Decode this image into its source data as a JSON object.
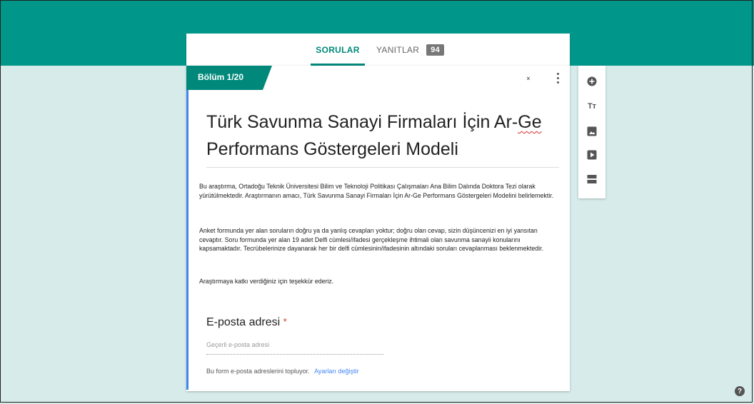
{
  "tabs": {
    "questions_label": "SORULAR",
    "responses_label": "YANITLAR",
    "responses_count": "94"
  },
  "section": {
    "label": "Bölüm 1/20",
    "title_part1": "Türk Savunma Sanayi Firmaları İçin Ar-",
    "title_part2": "Ge",
    "title_part3": "Performans Göstergeleri Modeli",
    "description_1": "Bu araştırma, Ortadoğu Teknik Üniversitesi Bilim ve Teknoloji Politikası Çalışmaları Ana Bilim Dalında Doktora Tezi olarak yürütülmektedir. Araştırmanın amacı, Türk Savunma Sanayi Firmaları İçin Ar-Ge Performans Göstergeleri Modelini belirlemektir.",
    "description_2": "Anket formunda yer alan soruların doğru ya da yanlış cevapları yoktur; doğru olan cevap, sizin düşüncenizi en iyi yansıtan cevaptır. Soru formunda yer alan 19 adet Delfi cümlesi/ifadesi gerçekleşme ihtimali olan savunma sanayii konularını kapsamaktadır. Tecrübelerinize dayanarak her bir delfi cümlesinin/ifadesinin altındaki soruları cevaplanması beklenmektedir.",
    "description_3": "Araştırmaya katkı verdiğiniz için teşekkür ederiz."
  },
  "email_question": {
    "title": "E-posta adresi",
    "required_mark": "*",
    "placeholder": "Geçerli e-posta adresi",
    "note": "Bu form e-posta adreslerini topluyor.",
    "settings_link": "Ayarları değiştir"
  },
  "toolbar": {
    "items": [
      "add-question-icon",
      "add-title-icon",
      "add-image-icon",
      "add-video-icon",
      "add-section-icon"
    ],
    "title_glyph": "Tт"
  },
  "help": "?",
  "colors": {
    "header": "#00968a",
    "background": "#d7ecea",
    "accent": "#00897b",
    "left_bar": "#4285f4"
  }
}
